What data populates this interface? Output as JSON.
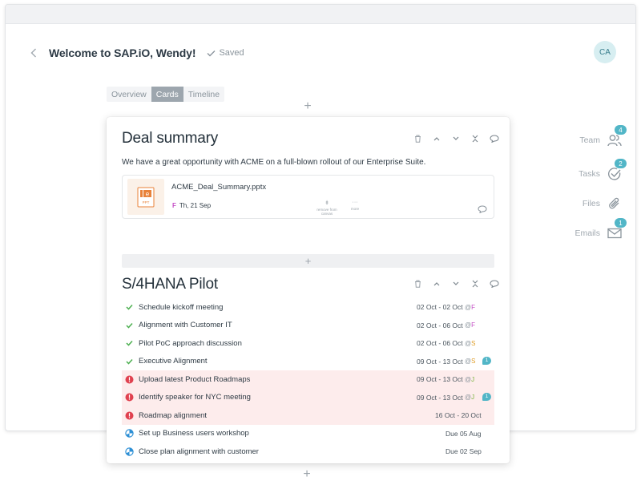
{
  "header": {
    "title": "Welcome to SAP.iO, Wendy!",
    "saved_label": "Saved",
    "avatar_initials": "CA"
  },
  "tabs": [
    {
      "label": "Overview",
      "active": false
    },
    {
      "label": "Cards",
      "active": true
    },
    {
      "label": "Timeline",
      "active": false
    }
  ],
  "right_rail": [
    {
      "label": "Team",
      "icon": "team-icon",
      "badge": "4"
    },
    {
      "label": "Tasks",
      "icon": "tasks-check-icon",
      "badge": "2"
    },
    {
      "label": "Files",
      "icon": "paperclip-icon",
      "badge": ""
    },
    {
      "label": "Emails",
      "icon": "envelope-icon",
      "badge": "1"
    }
  ],
  "deal_card": {
    "title": "Deal summary",
    "description": "We have a great opportunity with ACME on a full-blown rollout of our Enterprise Suite.",
    "attachment": {
      "file_name": "ACME_Deal_Summary.pptx",
      "file_type": "PPT",
      "owner_initial": "F",
      "date": "Th, 21 Sep",
      "remove_label": "remove from canvas",
      "more_label": "more"
    }
  },
  "pilot_card": {
    "title": "S/4HANA Pilot",
    "tasks": [
      {
        "name": "Schedule kickoff meeting",
        "status": "done",
        "dates": "02 Oct - 02 Oct",
        "owner": "F",
        "owner_color": "#c44bc5",
        "comments": ""
      },
      {
        "name": "Alignment with Customer IT",
        "status": "done",
        "dates": "02 Oct - 06 Oct",
        "owner": "F",
        "owner_color": "#c44bc5",
        "comments": ""
      },
      {
        "name": "Pilot PoC approach discussion",
        "status": "done",
        "dates": "02 Oct - 06 Oct",
        "owner": "S",
        "owner_color": "#e0a02c",
        "comments": ""
      },
      {
        "name": "Executive Alignment",
        "status": "done",
        "dates": "09 Oct - 13 Oct",
        "owner": "S",
        "owner_color": "#e0a02c",
        "comments": "1"
      },
      {
        "name": "Upload latest Product Roadmaps",
        "status": "alert",
        "dates": "09 Oct - 13 Oct",
        "owner": "J",
        "owner_color": "#7cb342",
        "comments": ""
      },
      {
        "name": "Identify speaker for NYC meeting",
        "status": "alert",
        "dates": "09 Oct - 13 Oct",
        "owner": "J",
        "owner_color": "#7cb342",
        "comments": "1"
      },
      {
        "name": "Roadmap alignment",
        "status": "alert",
        "dates": "16 Oct - 20 Oct",
        "owner": "",
        "owner_color": "",
        "comments": ""
      },
      {
        "name": "Set up Business users workshop",
        "status": "in-progress",
        "dates": "Due 05 Aug",
        "owner": "",
        "owner_color": "",
        "comments": ""
      },
      {
        "name": "Close plan alignment with customer",
        "status": "in-progress",
        "dates": "Due 02 Sep",
        "owner": "",
        "owner_color": "",
        "comments": ""
      }
    ]
  },
  "colors": {
    "accent": "#52b6c7",
    "done_check": "#4caf50",
    "alert_red": "#e0414f",
    "alert_row_bg": "#fdecec",
    "progress_blue": "#2d8fd5"
  }
}
